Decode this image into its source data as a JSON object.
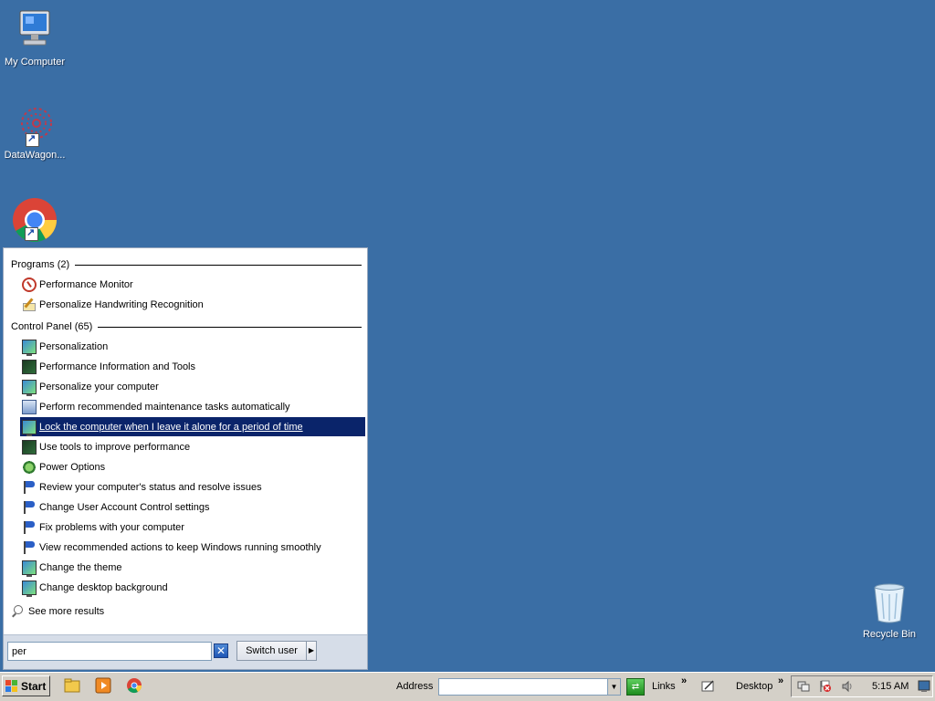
{
  "desktop": {
    "icons": [
      {
        "label": "My Computer"
      },
      {
        "label": "DataWagon..."
      },
      {
        "label": ""
      },
      {
        "label": "Recycle Bin"
      }
    ]
  },
  "start_menu": {
    "groups": [
      {
        "title": "Programs (2)",
        "items": [
          {
            "label": "Performance Monitor",
            "icon": "performance-monitor-icon"
          },
          {
            "label": "Personalize Handwriting Recognition",
            "icon": "handwriting-icon"
          }
        ]
      },
      {
        "title": "Control Panel (65)",
        "items": [
          {
            "label": "Personalization",
            "icon": "monitor-icon"
          },
          {
            "label": "Performance Information and Tools",
            "icon": "performance-icon"
          },
          {
            "label": "Personalize your computer",
            "icon": "monitor-icon"
          },
          {
            "label": "Perform recommended maintenance tasks automatically",
            "icon": "maintenance-icon"
          },
          {
            "label": "Lock the computer when I leave it alone for a period of time",
            "icon": "monitor-icon",
            "selected": true
          },
          {
            "label": "Use tools to improve performance",
            "icon": "performance-icon"
          },
          {
            "label": "Power Options",
            "icon": "power-icon"
          },
          {
            "label": "Review your computer's status and resolve issues",
            "icon": "flag-icon"
          },
          {
            "label": "Change User Account Control settings",
            "icon": "flag-icon"
          },
          {
            "label": "Fix problems with your computer",
            "icon": "flag-icon"
          },
          {
            "label": "View recommended actions to keep Windows running smoothly",
            "icon": "flag-icon"
          },
          {
            "label": "Change the theme",
            "icon": "monitor-icon"
          },
          {
            "label": "Change desktop background",
            "icon": "monitor-icon"
          }
        ]
      }
    ],
    "see_more": "See more results",
    "search_value": "per",
    "switch_user_label": "Switch user"
  },
  "taskbar": {
    "start_label": "Start",
    "address_label": "Address",
    "links_label": "Links",
    "desktop_label": "Desktop",
    "clock": "5:15 AM"
  },
  "colors": {
    "desktop_bg": "#3a6ea5",
    "selection_bg": "#0a246a"
  }
}
